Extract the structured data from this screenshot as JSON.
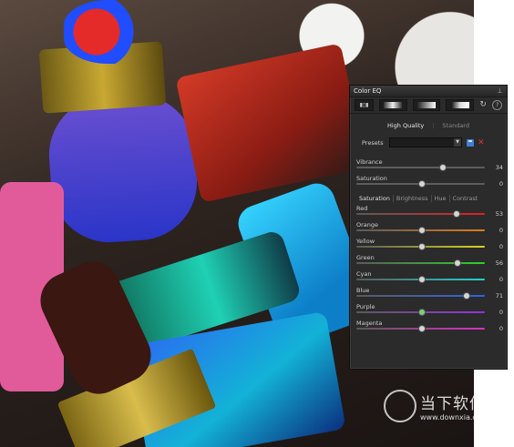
{
  "panel": {
    "title": "Color EQ",
    "quality_tabs": [
      "High Quality",
      "Standard"
    ],
    "presets_label": "Presets",
    "presets_value": "",
    "vibrance": {
      "label": "Vibrance",
      "value": "34",
      "level": 0.67
    },
    "saturation": {
      "label": "Saturation",
      "value": "0",
      "level": 0.5
    },
    "sub_tabs": [
      "Saturation",
      "Brightness",
      "Hue",
      "Contrast"
    ],
    "colors": [
      {
        "label": "Red",
        "value": "53",
        "level": 0.77,
        "color": "#e02020",
        "thumb": "#d6d6d6"
      },
      {
        "label": "Orange",
        "value": "0",
        "level": 0.5,
        "color": "#e07a1f",
        "thumb": "#d6d6d6"
      },
      {
        "label": "Yellow",
        "value": "0",
        "level": 0.5,
        "color": "#d8d31e",
        "thumb": "#d6d6d6"
      },
      {
        "label": "Green",
        "value": "56",
        "level": 0.78,
        "color": "#2bd22b",
        "thumb": "#d6d6d6"
      },
      {
        "label": "Cyan",
        "value": "0",
        "level": 0.5,
        "color": "#1fd3cf",
        "thumb": "#d6d6d6"
      },
      {
        "label": "Blue",
        "value": "71",
        "level": 0.85,
        "color": "#2e62e8",
        "thumb": "#d6d6d6"
      },
      {
        "label": "Purple",
        "value": "0",
        "level": 0.5,
        "color": "#9b2fe0",
        "thumb": "#7bd07b"
      },
      {
        "label": "Magenta",
        "value": "0",
        "level": 0.5,
        "color": "#d92fc4",
        "thumb": "#d6d6d6"
      }
    ],
    "icons": [
      "pin-icon",
      "gradient-icon",
      "gradient-icon",
      "gradient-icon",
      "reset-icon",
      "help-icon",
      "save-icon",
      "delete-icon"
    ]
  },
  "watermark": {
    "name": "当下软件园",
    "url": "www.downxia.com"
  }
}
